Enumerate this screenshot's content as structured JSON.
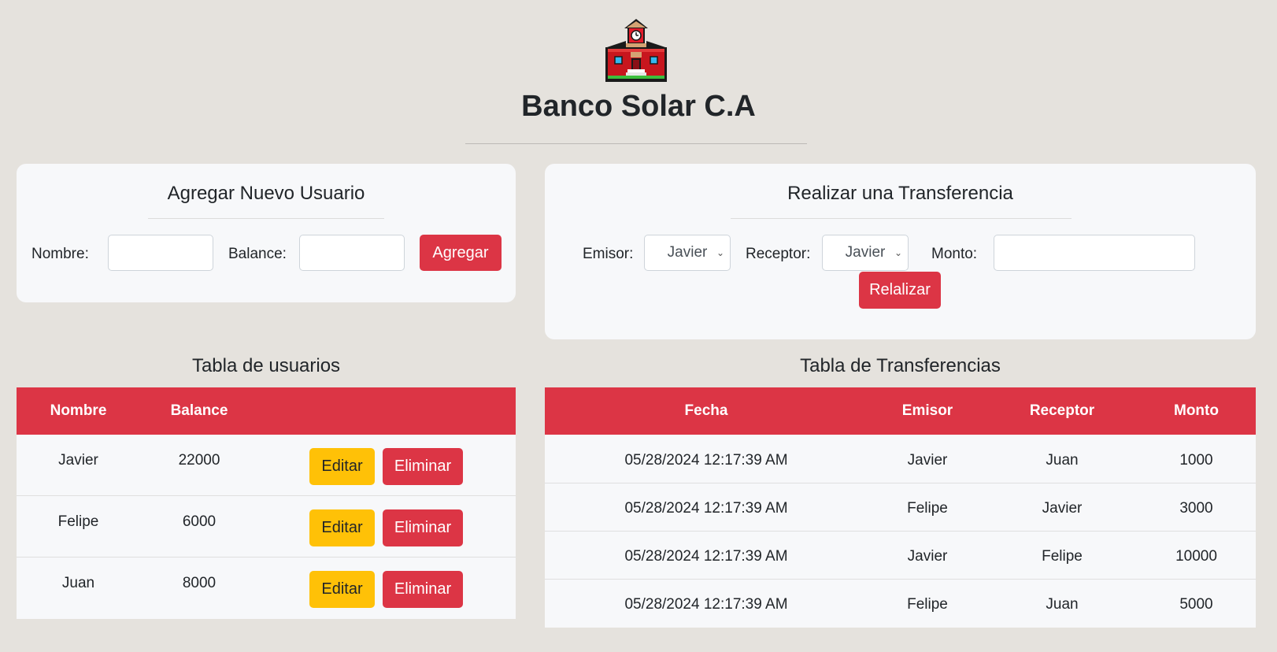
{
  "header": {
    "logo_icon": "school-building-icon",
    "title": "Banco Solar C.A"
  },
  "add_user": {
    "title": "Agregar Nuevo Usuario",
    "name_label": "Nombre:",
    "name_value": "",
    "balance_label": "Balance:",
    "balance_value": "",
    "submit_label": "Agregar"
  },
  "transfer": {
    "title": "Realizar una Transferencia",
    "sender_label": "Emisor:",
    "sender_selected": "Javier",
    "receiver_label": "Receptor:",
    "receiver_selected": "Javier",
    "amount_label": "Monto:",
    "amount_value": "",
    "submit_label": "Relalizar"
  },
  "users_table": {
    "title": "Tabla de usuarios",
    "columns": [
      "Nombre",
      "Balance",
      ""
    ],
    "edit_label": "Editar",
    "delete_label": "Eliminar",
    "rows": [
      {
        "name": "Javier",
        "balance": "22000"
      },
      {
        "name": "Felipe",
        "balance": "6000"
      },
      {
        "name": "Juan",
        "balance": "8000"
      }
    ]
  },
  "transfers_table": {
    "title": "Tabla de Transferencias",
    "columns": [
      "Fecha",
      "Emisor",
      "Receptor",
      "Monto"
    ],
    "rows": [
      {
        "date": "05/28/2024 12:17:39 AM",
        "sender": "Javier",
        "receiver": "Juan",
        "amount": "1000"
      },
      {
        "date": "05/28/2024 12:17:39 AM",
        "sender": "Felipe",
        "receiver": "Javier",
        "amount": "3000"
      },
      {
        "date": "05/28/2024 12:17:39 AM",
        "sender": "Javier",
        "receiver": "Felipe",
        "amount": "10000"
      },
      {
        "date": "05/28/2024 12:17:39 AM",
        "sender": "Felipe",
        "receiver": "Juan",
        "amount": "5000"
      }
    ]
  },
  "colors": {
    "background": "#e5e2dd",
    "card": "#f7f8fa",
    "primary_red": "#dc3545",
    "warning_yellow": "#ffc107"
  }
}
